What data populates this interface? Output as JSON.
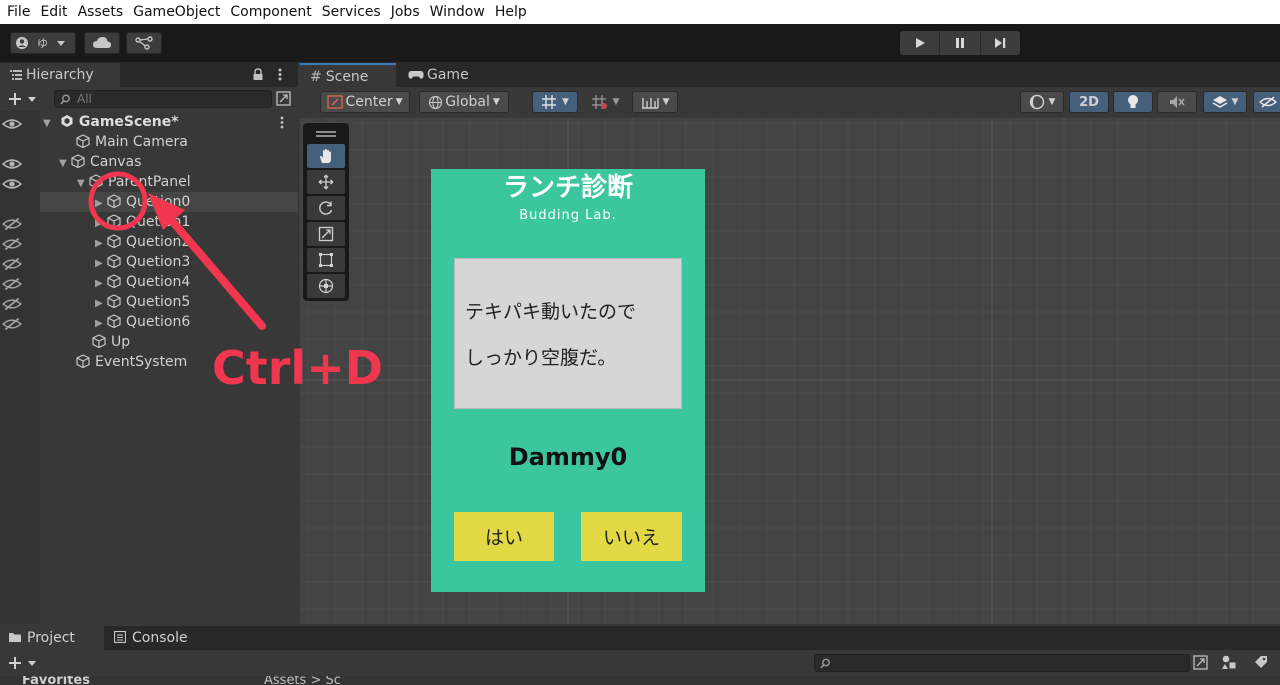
{
  "menu": [
    "File",
    "Edit",
    "Assets",
    "GameObject",
    "Component",
    "Services",
    "Jobs",
    "Window",
    "Help"
  ],
  "toolbar": {
    "account_icon": "account-icon",
    "collab_icon": "collab-icon",
    "cloud_icon": "cloud-icon",
    "version_icon": "version-control-icon",
    "play_icon": "play-icon",
    "pause_icon": "pause-icon",
    "step_icon": "step-icon"
  },
  "hierarchy": {
    "tab_label": "Hierarchy",
    "search_placeholder": "All",
    "scene_name": "GameScene*",
    "items": [
      {
        "label": "Main Camera"
      },
      {
        "label": "Canvas"
      },
      {
        "label": "ParentPanel"
      },
      {
        "label": "Quetion0"
      },
      {
        "label": "Quetion1"
      },
      {
        "label": "Quetion2"
      },
      {
        "label": "Quetion3"
      },
      {
        "label": "Quetion4"
      },
      {
        "label": "Quetion5"
      },
      {
        "label": "Quetion6"
      },
      {
        "label": "Up"
      },
      {
        "label": "EventSystem"
      }
    ]
  },
  "scene": {
    "tabs": [
      "Scene",
      "Game"
    ],
    "pivot": "Center",
    "space": "Global",
    "mode_2d": "2D"
  },
  "game_panel": {
    "title": "ランチ診断",
    "subtitle": "Budding Lab.",
    "question_line1": "テキパキ動いたので",
    "question_line2": "しっかり空腹だ。",
    "dummy": "Dammy0",
    "yes": "はい",
    "no": "いいえ",
    "bg_color": "#3cc6a0",
    "button_color": "#e3d944"
  },
  "annotation": {
    "text": "Ctrl+D",
    "color": "#f0374f"
  },
  "bottom": {
    "tabs": [
      "Project",
      "Console"
    ],
    "favorites": "Favorites",
    "breadcrumb": "Assets > Sc"
  }
}
